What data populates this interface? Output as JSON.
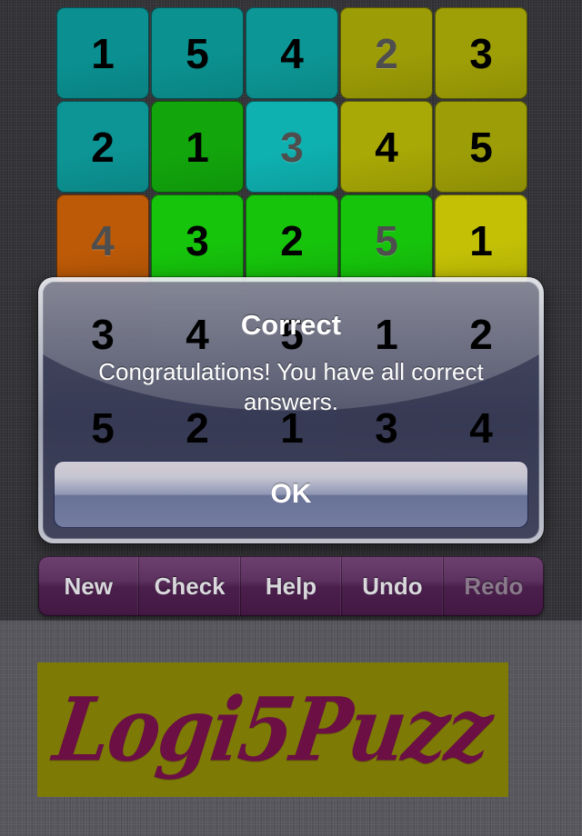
{
  "app": {
    "name": "Logi5Puzz",
    "logo_text": "Logi5Puzz",
    "background_color": "#313135",
    "background_color_lower": "#55555b",
    "logo_background_color": "#7d7a06",
    "logo_ink_color": "#6b0f44"
  },
  "grid": {
    "rows": 5,
    "columns": 5,
    "cells": [
      [
        {
          "value": "1",
          "state": "filled",
          "color": "#0b8f90"
        },
        {
          "value": "5",
          "state": "filled",
          "color": "#0b9190"
        },
        {
          "value": "4",
          "state": "filled",
          "color": "#0c9695"
        },
        {
          "value": "2",
          "state": "given",
          "color": "#9c9c07"
        },
        {
          "value": "3",
          "state": "filled",
          "color": "#9e9e07"
        }
      ],
      [
        {
          "value": "2",
          "state": "filled",
          "color": "#0d9494"
        },
        {
          "value": "1",
          "state": "filled",
          "color": "#12a50c"
        },
        {
          "value": "3",
          "state": "given",
          "color": "#0eb0b0"
        },
        {
          "value": "4",
          "state": "filled",
          "color": "#a8a806"
        },
        {
          "value": "5",
          "state": "filled",
          "color": "#9d9d07"
        }
      ],
      [
        {
          "value": "4",
          "state": "given",
          "color": "#bd5a07"
        },
        {
          "value": "3",
          "state": "filled",
          "color": "#16c40b"
        },
        {
          "value": "2",
          "state": "filled",
          "color": "#16c40b"
        },
        {
          "value": "5",
          "state": "given",
          "color": "#16c40b"
        },
        {
          "value": "1",
          "state": "filled",
          "color": "#c3c006"
        }
      ],
      [
        {
          "value": "3",
          "state": "filled",
          "color": "#3b3b46"
        },
        {
          "value": "4",
          "state": "filled",
          "color": "#1f6b57"
        },
        {
          "value": "5",
          "state": "filled",
          "color": "#4a2044"
        },
        {
          "value": "1",
          "state": "filled",
          "color": "#4b2448"
        },
        {
          "value": "2",
          "state": "filled",
          "color": "#4a2448"
        }
      ],
      [
        {
          "value": "5",
          "state": "filled",
          "color": "#352d3c"
        },
        {
          "value": "2",
          "state": "filled",
          "color": "#342c3b"
        },
        {
          "value": "1",
          "state": "filled",
          "color": "#342c3b"
        },
        {
          "value": "3",
          "state": "filled",
          "color": "#46203f"
        },
        {
          "value": "4",
          "state": "filled",
          "color": "#43203e"
        }
      ]
    ]
  },
  "dialog": {
    "visible": true,
    "title": "Correct",
    "message": "Congratulations! You have all correct answers.",
    "ok_label": "OK"
  },
  "toolbar": {
    "buttons": [
      {
        "label": "New",
        "enabled": true
      },
      {
        "label": "Check",
        "enabled": true
      },
      {
        "label": "Help",
        "enabled": true
      },
      {
        "label": "Undo",
        "enabled": true
      },
      {
        "label": "Redo",
        "enabled": false
      }
    ]
  }
}
